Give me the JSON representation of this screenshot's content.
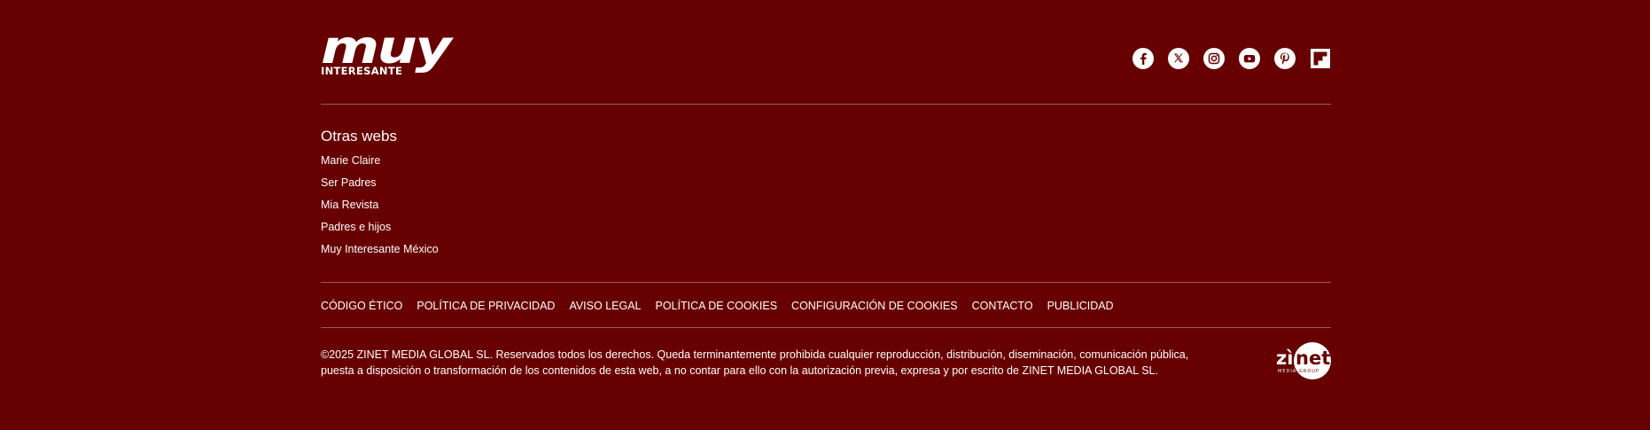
{
  "brand": {
    "logo_word": "muy",
    "logo_sub": "INTERESANTE"
  },
  "social": [
    {
      "name": "facebook-icon"
    },
    {
      "name": "x-icon"
    },
    {
      "name": "instagram-icon"
    },
    {
      "name": "youtube-icon"
    },
    {
      "name": "pinterest-icon"
    },
    {
      "name": "flipboard-icon"
    }
  ],
  "otras_webs": {
    "title": "Otras webs",
    "links": [
      "Marie Claire",
      "Ser Padres",
      "Mia Revista",
      "Padres e hijos",
      "Muy Interesante México"
    ]
  },
  "legal_links": [
    "CÓDIGO ÉTICO",
    "POLÍTICA DE PRIVACIDAD",
    "AVISO LEGAL",
    "POLÍTICA DE COOKIES",
    "CONFIGURACIÓN DE COOKIES",
    "CONTACTO",
    "PUBLICIDAD"
  ],
  "copyright": "©2025 ZINET MEDIA GLOBAL SL. Reservados todos los derechos. Queda terminantemente prohibida cualquier reproducción, distribución, diseminación, comunicación pública, puesta a disposición o transformación de los contenidos de esta web, a no contar para ello con la autorización previa, expresa y por escrito de ZINET MEDIA GLOBAL SL.",
  "publisher_logo": {
    "word": "zìnet",
    "sub": "MEDIA GROUP"
  },
  "colors": {
    "background": "#670000",
    "text": "#ffffff",
    "divider": "#9a5a5a"
  }
}
